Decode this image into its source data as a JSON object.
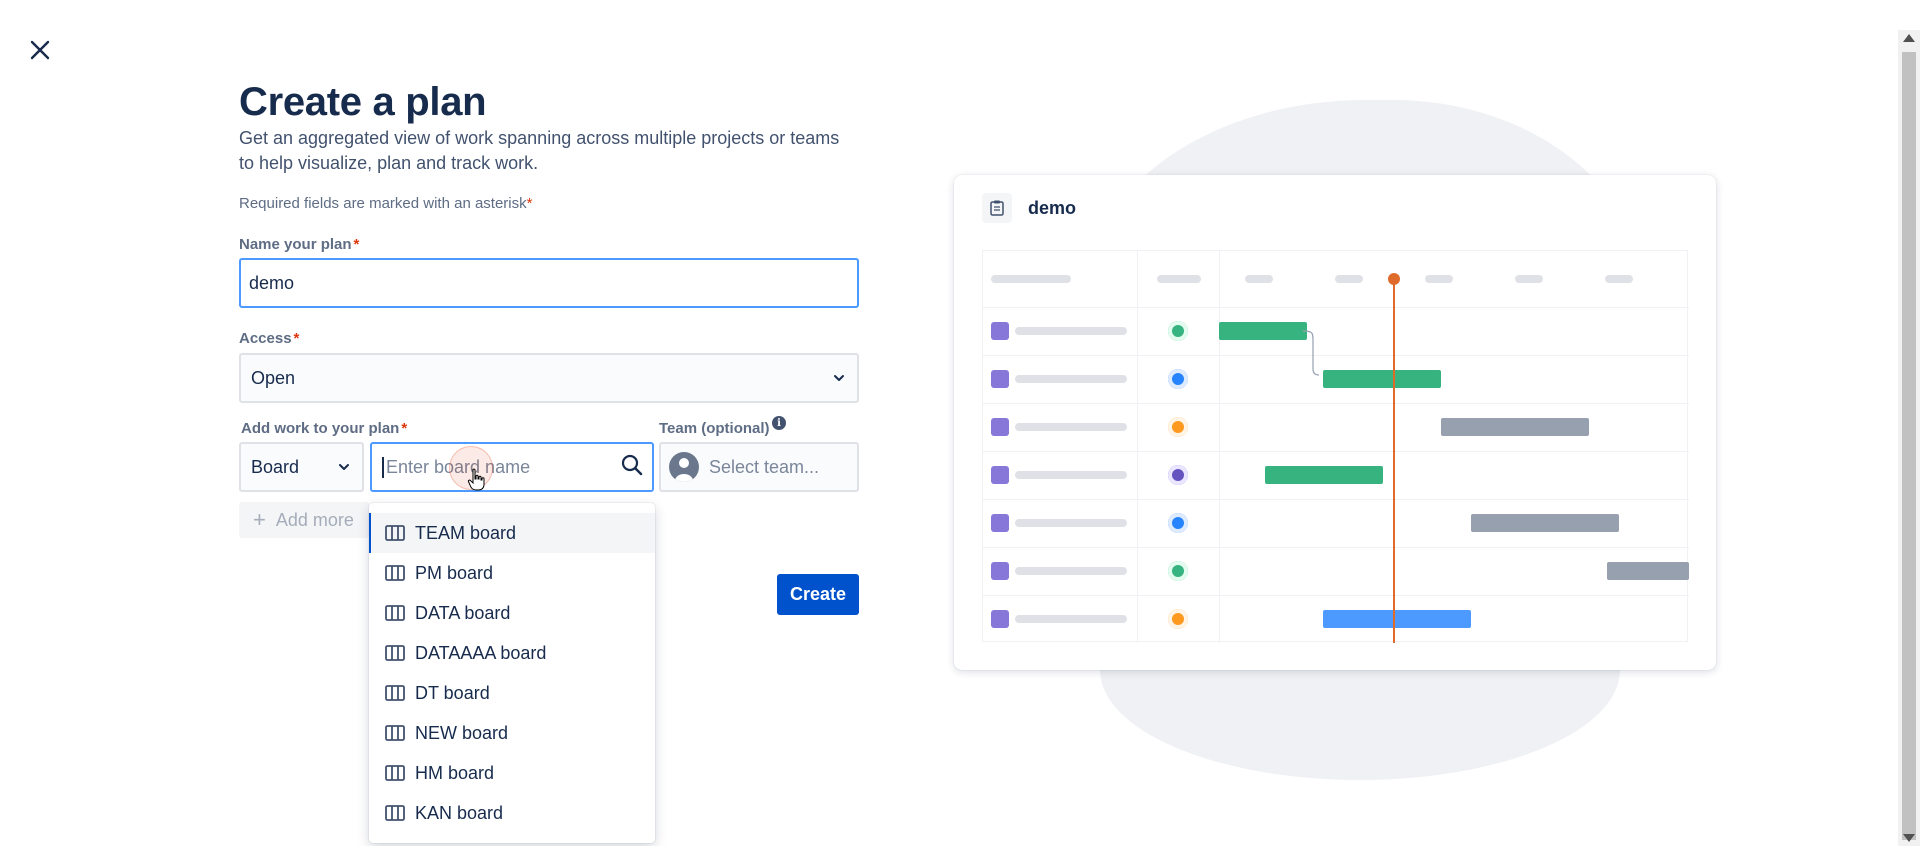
{
  "page": {
    "title": "Create a plan",
    "description": "Get an aggregated view of work spanning across multiple projects or teams to help visualize, plan and track work.",
    "required_note": "Required fields are marked with an asterisk",
    "asterisk": "*"
  },
  "form": {
    "name_label": "Name your plan",
    "name_value": "demo",
    "access_label": "Access",
    "access_value": "Open",
    "add_work_label": "Add work to your plan",
    "source_type_value": "Board",
    "board_search_placeholder": "Enter board name",
    "team_label": "Team (optional)",
    "team_placeholder": "Select team...",
    "add_more_label": "Add more",
    "create_label": "Create"
  },
  "dropdown": {
    "items": [
      {
        "label": "TEAM board"
      },
      {
        "label": "PM board"
      },
      {
        "label": "DATA board"
      },
      {
        "label": "DATAAAA board"
      },
      {
        "label": "DT board"
      },
      {
        "label": "NEW board"
      },
      {
        "label": "HM board"
      },
      {
        "label": "KAN board"
      }
    ],
    "selected_index": 0
  },
  "illustration": {
    "plan_name": "demo"
  },
  "colors": {
    "primary": "#0052cc",
    "focus_border": "#4c9aff",
    "asterisk": "#de350b",
    "bar_green": "#36b37e",
    "bar_gray": "#97a0af",
    "bar_blue": "#4c9aff",
    "issue_purple": "#8777d9",
    "today_line": "#de6b2a"
  },
  "icons": {
    "close": "close-icon",
    "chevron": "chevron-down-icon",
    "search": "search-icon",
    "board": "board-icon",
    "info": "info-icon",
    "plus": "plus-icon",
    "team": "team-avatar-icon",
    "plan": "plan-icon"
  }
}
